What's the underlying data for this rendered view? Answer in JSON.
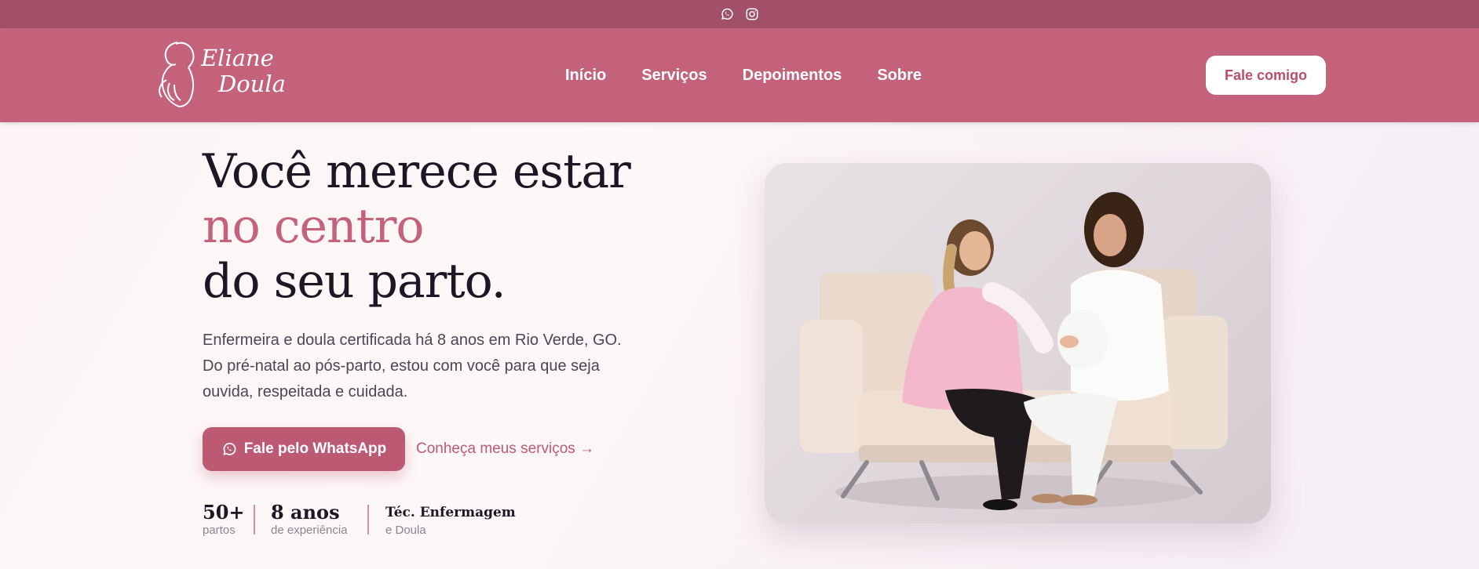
{
  "topbar": {
    "icons": [
      "whatsapp-icon",
      "instagram-icon"
    ],
    "background": "#a24f68"
  },
  "brand": {
    "line1": "Eliane",
    "line2": "Doula"
  },
  "nav": {
    "items": [
      {
        "label": "Início"
      },
      {
        "label": "Serviços"
      },
      {
        "label": "Depoimentos"
      },
      {
        "label": "Sobre"
      }
    ],
    "cta_label": "Fale comigo",
    "background": "#c4627b"
  },
  "hero": {
    "title_line1": "Você merece estar",
    "title_line2": "no centro",
    "title_line3": "do seu parto.",
    "description": "Enfermeira e doula certificada há 8 anos em Rio Verde, GO. Do pré-natal ao pós-parto, estou com você para que seja ouvida, respeitada e cuidada.",
    "primary_cta": "Fale pelo WhatsApp",
    "secondary_cta": "Conheça meus serviços →",
    "stats": [
      {
        "value": "50+",
        "label": "partos"
      },
      {
        "value": "8 anos",
        "label": "de experiência"
      },
      {
        "value": "Téc. Enfermagem",
        "label": "e Doula"
      }
    ],
    "accent_color": "#c4627b"
  }
}
